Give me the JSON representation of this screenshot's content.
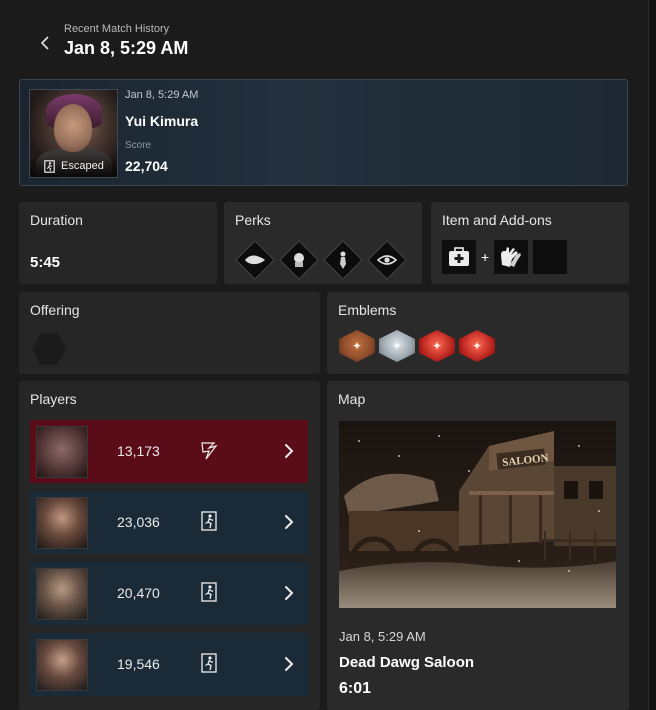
{
  "header": {
    "subtitle": "Recent Match History",
    "title": "Jan 8, 5:29 AM"
  },
  "summary": {
    "date": "Jan 8, 5:29 AM",
    "character": "Yui Kimura",
    "status": "Escaped",
    "score_label": "Score",
    "score": "22,704"
  },
  "duration": {
    "label": "Duration",
    "value": "5:45"
  },
  "perks": {
    "label": "Perks",
    "items": [
      "perk-1-icon",
      "perk-2-icon",
      "perk-3-icon",
      "perk-4-icon"
    ]
  },
  "items": {
    "label": "Item and Add-ons",
    "item_icon": "medkit-icon",
    "addon_icon": "gloves-icon"
  },
  "offering": {
    "label": "Offering"
  },
  "emblems": {
    "label": "Emblems",
    "colors": [
      "#8a4a2a",
      "#9aa4ac",
      "#b8231f",
      "#b8231f"
    ]
  },
  "players": {
    "label": "Players",
    "rows": [
      {
        "role": "killer",
        "score": "13,173",
        "status_icon": "sacrificed-icon"
      },
      {
        "role": "survivor",
        "score": "23,036",
        "status_icon": "escaped-icon"
      },
      {
        "role": "survivor",
        "score": "20,470",
        "status_icon": "escaped-icon"
      },
      {
        "role": "survivor",
        "score": "19,546",
        "status_icon": "escaped-icon"
      }
    ]
  },
  "map": {
    "label": "Map",
    "sign_text": "SALOON",
    "date": "Jan 8, 5:29 AM",
    "name": "Dead Dawg Saloon",
    "duration": "6:01"
  },
  "colors": {
    "killer_row": "#5a0d18",
    "survivor_row": "#1a2b37",
    "card_bg": "#262626"
  }
}
